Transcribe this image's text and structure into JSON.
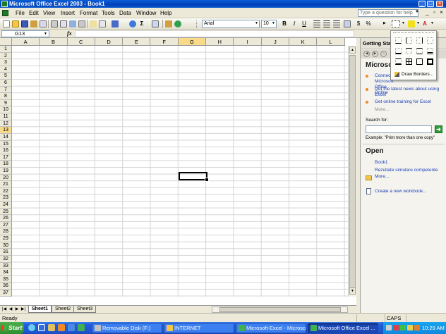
{
  "window": {
    "title": "Microsoft Office Excel 2003 - Book1",
    "min": "_",
    "max": "□",
    "close": "×"
  },
  "menu": {
    "items": [
      "File",
      "Edit",
      "View",
      "Insert",
      "Format",
      "Tools",
      "Data",
      "Window",
      "Help"
    ],
    "help_placeholder": "Type a question for help"
  },
  "toolbar": {
    "font_name": "Arial",
    "font_size": "10",
    "bold": "B",
    "italic": "I",
    "underline": "U",
    "sigma": "Σ",
    "currency": "$",
    "percent": "%"
  },
  "formula_bar": {
    "cell_ref": "G13",
    "fx": "fx",
    "value": ""
  },
  "grid": {
    "columns": [
      "A",
      "B",
      "C",
      "D",
      "E",
      "F",
      "G",
      "H",
      "I",
      "J",
      "K",
      "L"
    ],
    "rows": [
      "1",
      "2",
      "3",
      "4",
      "5",
      "6",
      "7",
      "8",
      "9",
      "10",
      "11",
      "12",
      "13",
      "14",
      "15",
      "16",
      "17",
      "18",
      "19",
      "20",
      "21",
      "22",
      "23",
      "24",
      "25",
      "26",
      "27",
      "28",
      "29",
      "30",
      "31",
      "32",
      "33",
      "34",
      "35",
      "36",
      "37"
    ],
    "active_column": "G",
    "active_row": "13"
  },
  "sheets": {
    "tabs": [
      "Sheet1",
      "Sheet2",
      "Sheet3"
    ],
    "active": "Sheet1"
  },
  "task_pane": {
    "header": "Getting Started",
    "office_title": "Microsoft Office Online",
    "links": [
      "Connect to Microsoft Office Online",
      "Get the latest news about using Excel",
      "Get online training for Excel"
    ],
    "more1": "More...",
    "search_label": "Search for:",
    "search_value": "",
    "example": "Example:  \"Print more than one copy\"",
    "open_title": "Open",
    "open_links": [
      "Book1",
      "Rezultate simulare competente"
    ],
    "open_more": "More...",
    "create_link": "Create a new workbook..."
  },
  "borders_dropdown": {
    "draw_label": "Draw Borders..."
  },
  "status": {
    "text": "Ready",
    "caps": "CAPS"
  },
  "taskbar": {
    "start": "Start",
    "buttons": [
      "Removable Disk (F:)",
      "INTERNET",
      "Microsoft-Excel - Microso...",
      "Microsoft Office Excel ..."
    ],
    "active_index": 3,
    "time": "10:29 AM"
  },
  "colors": {
    "title_blue": "#0041b8",
    "excel_green": "#1f7a2a",
    "active_header": "#f9d98a",
    "link_blue": "#1a3fb8",
    "bullet_orange": "#f08a24"
  }
}
